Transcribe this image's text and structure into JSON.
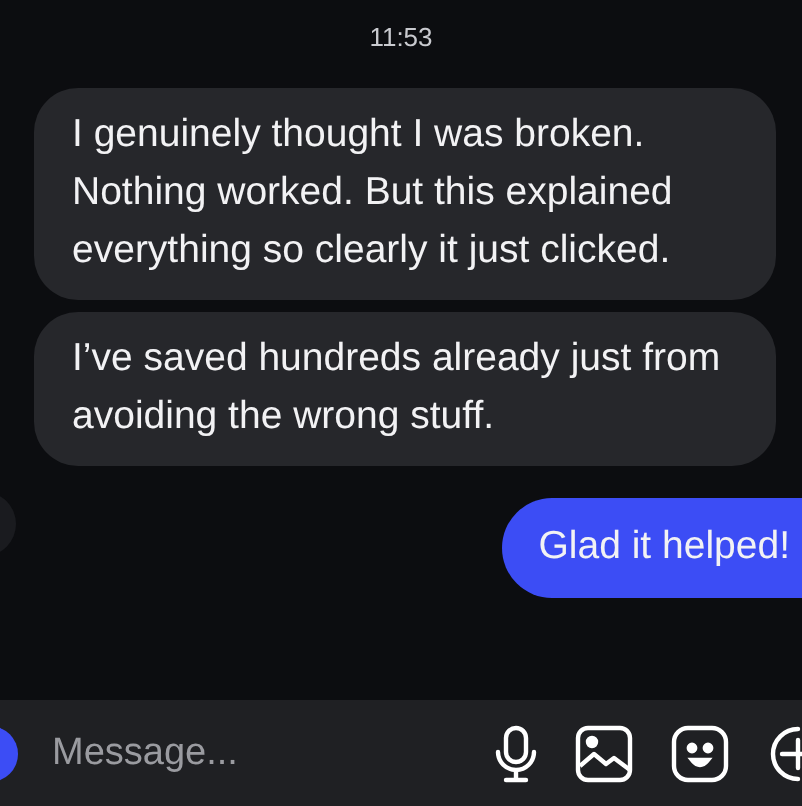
{
  "timestamp": "11:53",
  "messages": [
    {
      "text": "I genuinely thought I was broken. Nothing worked. But this explained everything so clearly it just clicked.",
      "outgoing": false
    },
    {
      "text": "I’ve saved hundreds already just from avoiding the wrong stuff.",
      "outgoing": false
    },
    {
      "text": "Glad it helped!",
      "outgoing": true
    }
  ],
  "composer": {
    "placeholder": "Message..."
  }
}
